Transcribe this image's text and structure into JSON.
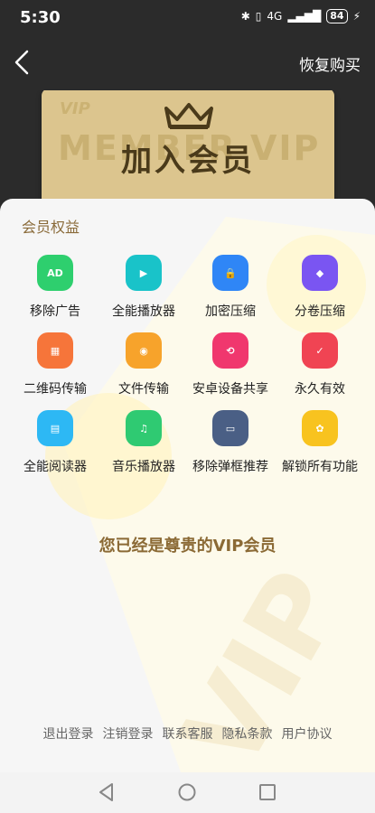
{
  "status": {
    "time": "5:30",
    "signal": "4G",
    "battery": "84"
  },
  "header": {
    "back_icon": "chevron-left-icon",
    "restore_label": "恢复购买"
  },
  "hero": {
    "tag": "VIP",
    "bg_text": "MEMBER VIP",
    "title": "加入会员",
    "crown_icon": "crown-icon"
  },
  "benefits": {
    "title": "会员权益",
    "items": [
      {
        "label": "移除广告",
        "icon": "ad-icon",
        "glyph": "AD",
        "color": "#2ecf6e"
      },
      {
        "label": "全能播放器",
        "icon": "play-icon",
        "glyph": "▶",
        "color": "#19c3c9"
      },
      {
        "label": "加密压缩",
        "icon": "lock-icon",
        "glyph": "🔒",
        "color": "#2f86f6"
      },
      {
        "label": "分卷压缩",
        "icon": "layers-icon",
        "glyph": "◆",
        "color": "#7a55f2"
      },
      {
        "label": "二维码传输",
        "icon": "qr-code-icon",
        "glyph": "▦",
        "color": "#f6753a"
      },
      {
        "label": "文件传输",
        "icon": "rss-icon",
        "glyph": "◉",
        "color": "#f7a32b"
      },
      {
        "label": "安卓设备共享",
        "icon": "share-icon",
        "glyph": "⟲",
        "color": "#f0376e"
      },
      {
        "label": "永久有效",
        "icon": "check-circle-icon",
        "glyph": "✓",
        "color": "#f04453"
      },
      {
        "label": "全能阅读器",
        "icon": "book-icon",
        "glyph": "▤",
        "color": "#2db8f4"
      },
      {
        "label": "音乐播放器",
        "icon": "music-icon",
        "glyph": "♫",
        "color": "#2fca72"
      },
      {
        "label": "移除弹框推荐",
        "icon": "popup-icon",
        "glyph": "▭",
        "color": "#4a5f85"
      },
      {
        "label": "解锁所有功能",
        "icon": "unlock-icon",
        "glyph": "✿",
        "color": "#f8c31f"
      }
    ]
  },
  "vip_message": "您已经是尊贵的VIP会员",
  "footer": {
    "links": [
      "退出登录",
      "注销登录",
      "联系客服",
      "隐私条款",
      "用户协议"
    ]
  },
  "navbar": {
    "back_icon": "nav-back-icon",
    "home_icon": "nav-home-icon",
    "recents_icon": "nav-recents-icon"
  }
}
